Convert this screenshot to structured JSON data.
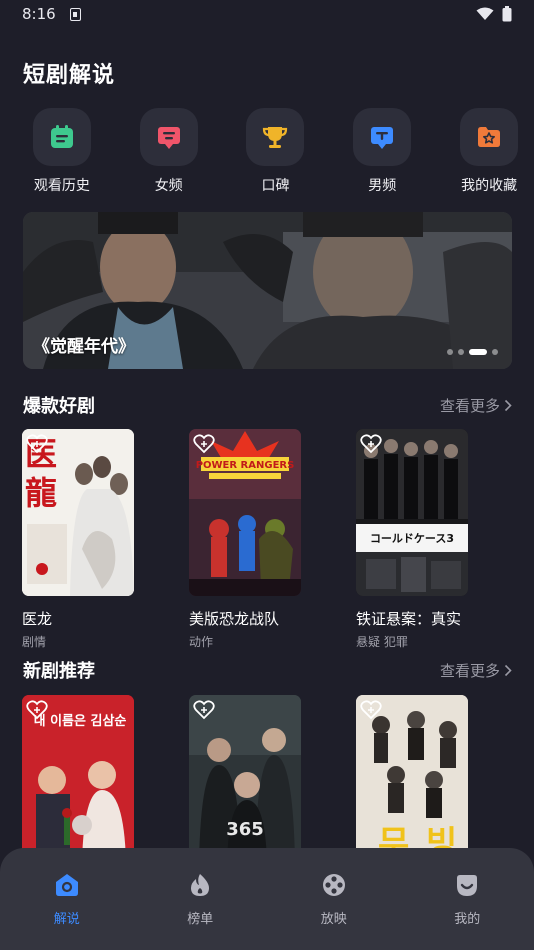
{
  "status": {
    "time": "8:16"
  },
  "header": {
    "title": "短剧解说"
  },
  "categories": [
    {
      "label": "观看历史",
      "icon": "calendar-icon",
      "color": "#3ec98e"
    },
    {
      "label": "女频",
      "icon": "female-channel-icon",
      "color": "#f0556a"
    },
    {
      "label": "口碑",
      "icon": "trophy-icon",
      "color": "#f0b429"
    },
    {
      "label": "男频",
      "icon": "male-channel-icon",
      "color": "#3d8bff"
    },
    {
      "label": "我的收藏",
      "icon": "favorites-folder-icon",
      "color": "#f07a3a"
    }
  ],
  "banner": {
    "caption": "《觉醒年代》",
    "dots": 4,
    "active_dot": 2
  },
  "hot": {
    "title": "爆款好剧",
    "more": "查看更多",
    "items": [
      {
        "title": "医龙",
        "tag": "剧情",
        "poster_text": "医龍"
      },
      {
        "title": "美版恐龙战队",
        "tag": "动作",
        "poster_text": "POWER RANGERS"
      },
      {
        "title": "铁证悬案：真实",
        "tag": "悬疑 犯罪",
        "poster_text": "コールドケース3"
      }
    ]
  },
  "new": {
    "title": "新剧推荐",
    "more": "查看更多",
    "items": [
      {
        "title": "",
        "tag": "",
        "poster_text": "내 이름은 김삼순"
      },
      {
        "title": "",
        "tag": "",
        "poster_text": "365"
      },
      {
        "title": "",
        "tag": "",
        "poster_text": "무빙"
      }
    ]
  },
  "nav": {
    "items": [
      {
        "label": "解说",
        "icon": "home-icon",
        "active": true
      },
      {
        "label": "榜单",
        "icon": "flame-icon",
        "active": false
      },
      {
        "label": "放映",
        "icon": "film-reel-icon",
        "active": false
      },
      {
        "label": "我的",
        "icon": "profile-face-icon",
        "active": false
      }
    ]
  },
  "colors": {
    "background": "#1e1e29",
    "accent": "#3d8bff",
    "nav_bg": "#34353f"
  }
}
